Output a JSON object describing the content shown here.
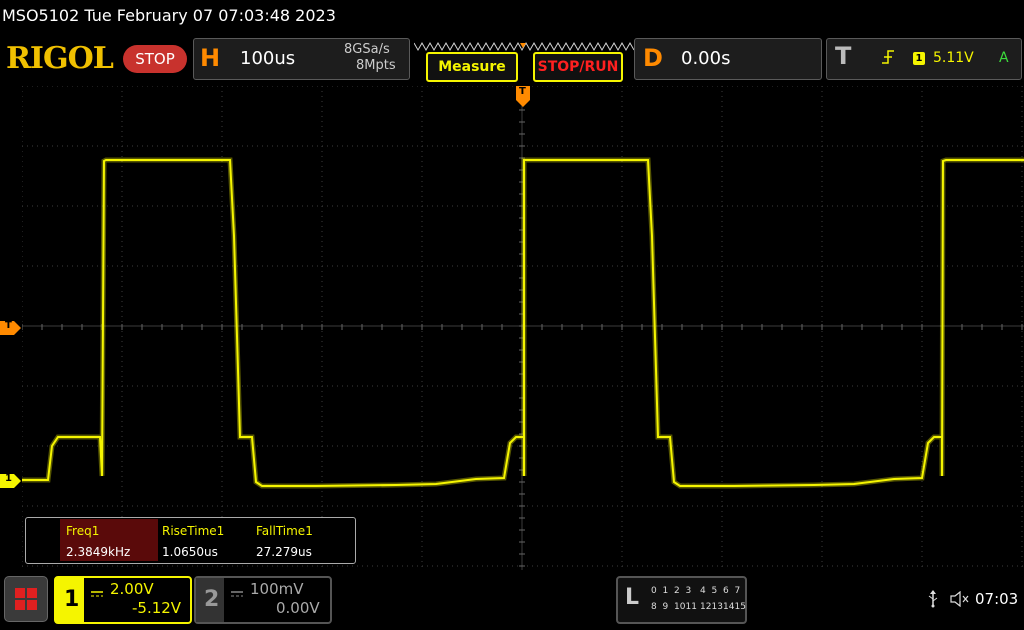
{
  "titlebar": {
    "text": "MSO5102  Tue February 07 07:03:48 2023"
  },
  "toolbar": {
    "logo": "RIGOL",
    "run_state": "STOP",
    "horizontal": {
      "label": "H",
      "timebase": "100us",
      "sample_rate": "8GSa/s",
      "memory_depth": "8Mpts"
    },
    "measure_button": "Measure",
    "stop_run_button": "STOP/RUN",
    "delay": {
      "label": "D",
      "value": "0.00s"
    },
    "trigger": {
      "label": "T",
      "source": "1",
      "level": "5.11V",
      "coupling": "A"
    }
  },
  "screen": {
    "trigger_marker": "T",
    "ch1_marker": "1",
    "time_marker": "T",
    "colors": {
      "ch1": "#f5f500",
      "grid": "#3c3c3c",
      "marker": "#ff8a00"
    }
  },
  "measurements": {
    "items": [
      {
        "name": "Freq1",
        "value": "2.3849kHz"
      },
      {
        "name": "RiseTime1",
        "value": "1.0650us"
      },
      {
        "name": "FallTime1",
        "value": "27.279us"
      }
    ]
  },
  "bottombar": {
    "ch1": {
      "number": "1",
      "scale": "2.00V",
      "offset": "-5.12V"
    },
    "ch2": {
      "number": "2",
      "scale": "100mV",
      "offset": "0.00V"
    },
    "logic": {
      "label": "L",
      "row1": [
        "0",
        "1",
        "2",
        "3",
        "4",
        "5",
        "6",
        "7"
      ],
      "row2": [
        "8",
        "9",
        "10",
        "11",
        "12",
        "13",
        "14",
        "15"
      ]
    },
    "time": "07:03"
  }
}
